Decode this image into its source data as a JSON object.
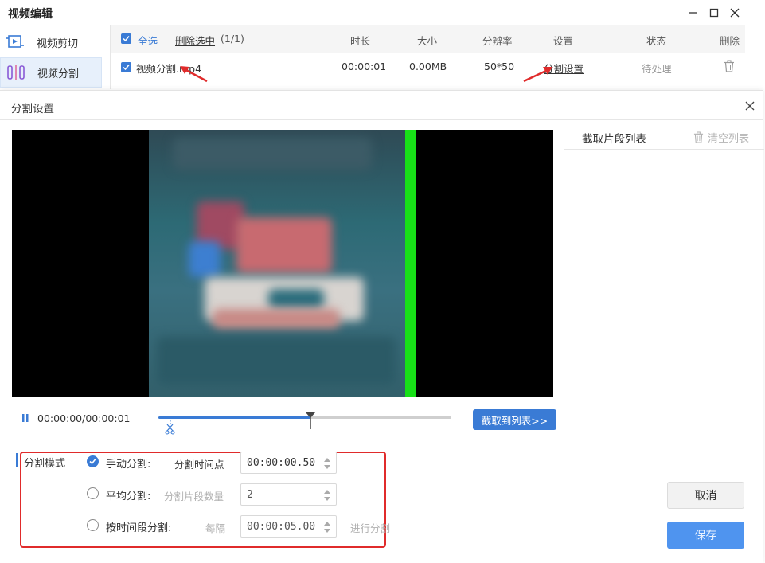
{
  "window": {
    "title": "视频编辑",
    "minimize_icon": "minimize-icon",
    "maximize_icon": "maximize-icon",
    "close_icon": "close-icon"
  },
  "sidebar": {
    "items": [
      {
        "label": "视频剪切",
        "icon": "video-cut-icon",
        "active": false
      },
      {
        "label": "视频分割",
        "icon": "video-split-icon",
        "active": true
      }
    ]
  },
  "file_table": {
    "select_all": "全选",
    "delete_selected": "删除选中",
    "count": "(1/1)",
    "headers": {
      "duration": "时长",
      "size": "大小",
      "resolution": "分辨率",
      "settings": "设置",
      "status": "状态",
      "delete": "删除"
    },
    "rows": [
      {
        "filename": "视频分割.mp4",
        "duration": "00:00:01",
        "size": "0.00MB",
        "resolution": "50*50",
        "settings_link": "分割设置",
        "status": "待处理"
      }
    ]
  },
  "dialog": {
    "title": "分割设置",
    "player": {
      "timecode": "00:00:00/00:00:01",
      "progress": 0.52,
      "cut_button": "截取到列表>>"
    },
    "clip_list": {
      "title": "截取片段列表",
      "clear_label": "清空列表"
    },
    "split_mode": {
      "label": "分割模式",
      "options": [
        {
          "label": "手动分割:",
          "selected": true,
          "field_label": "分割时间点",
          "value": "00:00:00.50",
          "disabled": false
        },
        {
          "label": "平均分割:",
          "selected": false,
          "field_label": "分割片段数量",
          "value": "2",
          "disabled": true
        },
        {
          "label": "按时间段分割:",
          "selected": false,
          "field_label": "每隔",
          "value": "00:00:05.00",
          "disabled": true,
          "suffix": "进行分割"
        }
      ]
    },
    "buttons": {
      "cancel": "取消",
      "save": "保存"
    }
  },
  "colors": {
    "accent": "#3a7bd5",
    "highlight_box": "#e02b2b",
    "save_button": "#4f94ef"
  }
}
